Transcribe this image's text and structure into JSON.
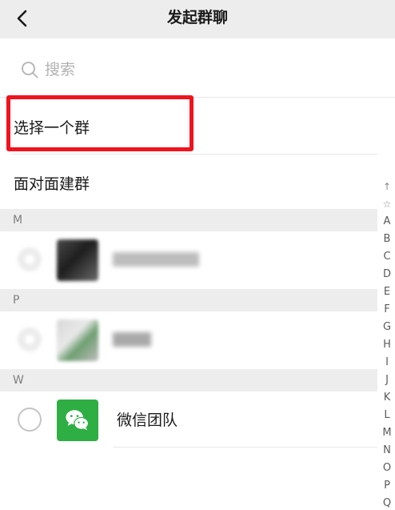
{
  "header": {
    "title": "发起群聊"
  },
  "search": {
    "placeholder": "搜索"
  },
  "actions": {
    "select_group": "选择一个群",
    "face_to_face": "面对面建群"
  },
  "sections": [
    {
      "letter": "M",
      "contact": {
        "name": ""
      }
    },
    {
      "letter": "P",
      "contact": {
        "name": ""
      }
    },
    {
      "letter": "W",
      "contact": {
        "name": "微信团队"
      }
    }
  ],
  "index_bar": [
    "↑",
    "☆",
    "A",
    "B",
    "C",
    "D",
    "E",
    "F",
    "G",
    "H",
    "I",
    "J",
    "K",
    "L",
    "M",
    "N",
    "O",
    "P",
    "Q"
  ],
  "colors": {
    "header_bg": "#ededed",
    "highlight_border": "#f0131e",
    "wechat_green": "#2fae44"
  }
}
